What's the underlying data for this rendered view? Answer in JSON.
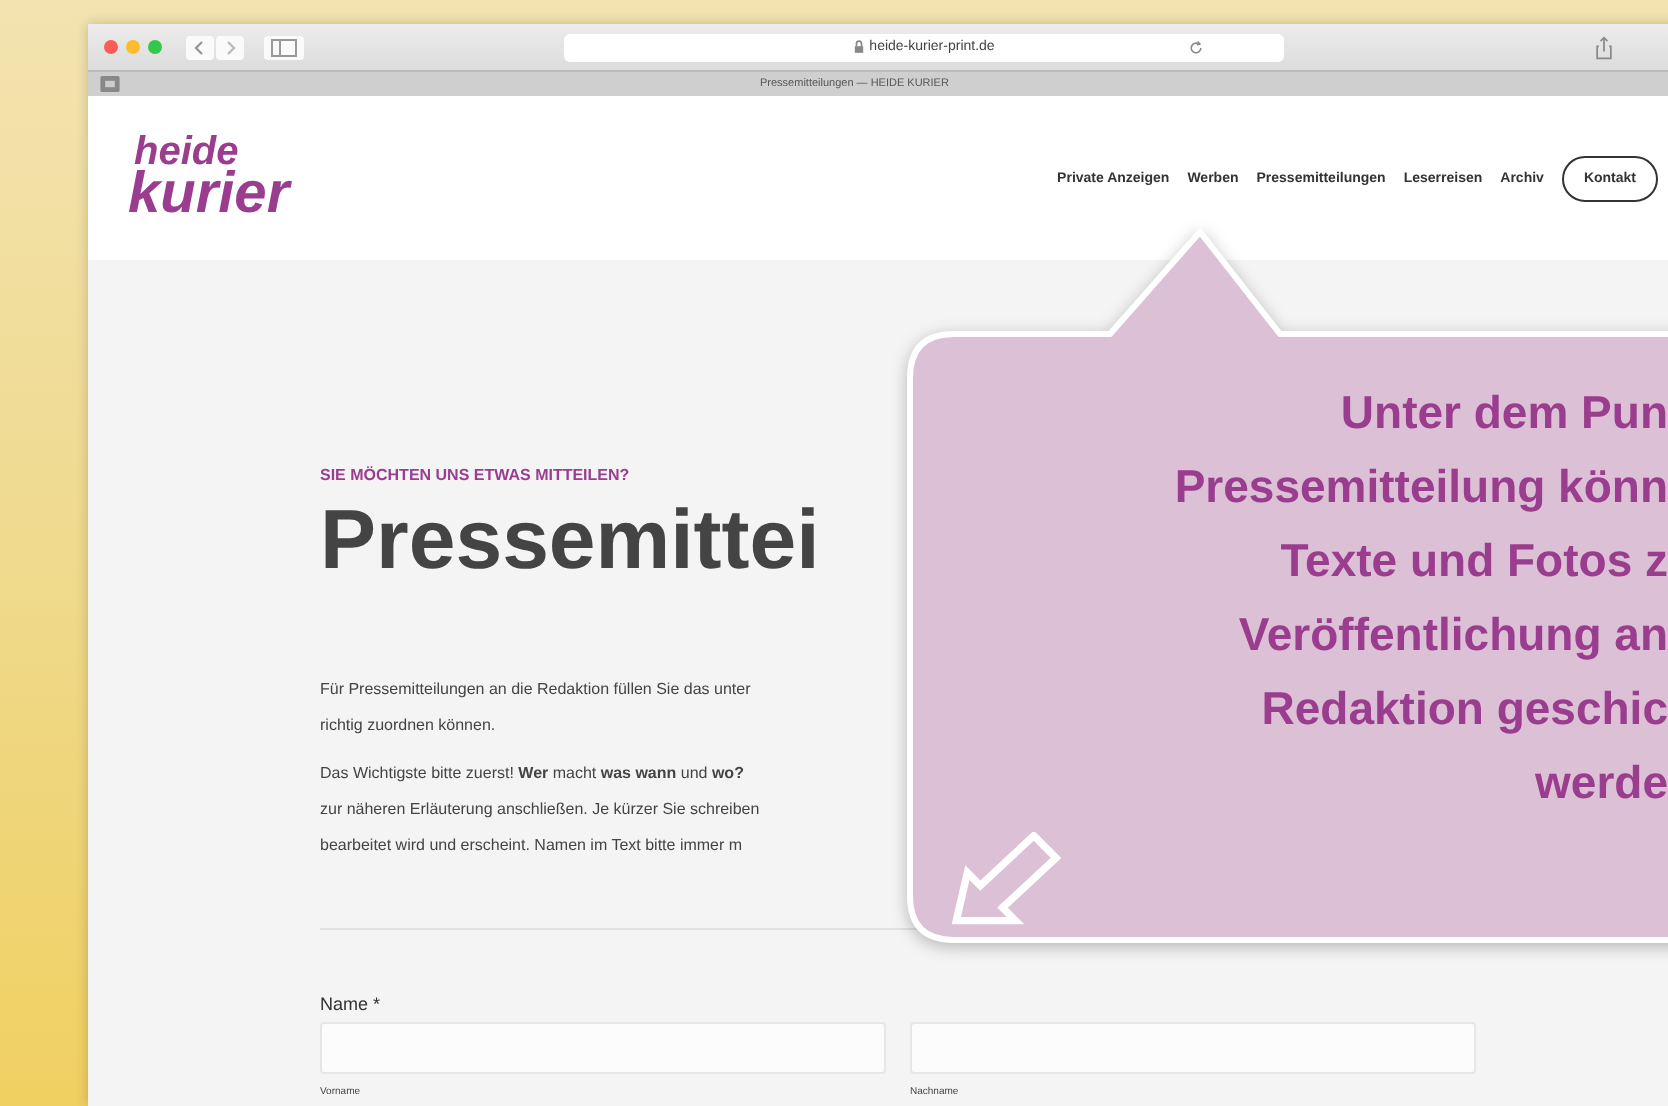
{
  "browser": {
    "url": "heide-kurier-print.de",
    "tab_title": "Pressemitteilungen — HEIDE KURIER"
  },
  "header": {
    "logo_lines": [
      "heide",
      "kurier"
    ],
    "nav": [
      {
        "label": "Private Anzeigen",
        "kind": "link"
      },
      {
        "label": "Werben",
        "kind": "link"
      },
      {
        "label": "Pressemitteilungen",
        "kind": "link"
      },
      {
        "label": "Leserreisen",
        "kind": "link"
      },
      {
        "label": "Archiv",
        "kind": "link"
      },
      {
        "label": "Kontakt",
        "kind": "button"
      }
    ]
  },
  "content": {
    "eyebrow": "SIE MÖCHTEN UNS ETWAS MITTEILEN?",
    "heading": "Pressemittei",
    "paragraphs": [
      [
        "Für Pressemitteilungen an die Redaktion füllen Sie das unter",
        "richtig zuordnen können."
      ],
      [
        "Das Wichtigste bitte zuerst! **Wer** macht **was wann** und **wo?**",
        "zur näheren Erläuterung anschließen. Je kürzer Sie schreiben",
        "bearbeitet wird und erscheint. Namen im Text bitte immer m"
      ]
    ],
    "form": {
      "label": "Name *",
      "fields": [
        {
          "sublabel": "Vorname"
        },
        {
          "sublabel": "Nachname"
        }
      ]
    }
  },
  "callout": {
    "lines": [
      "Unter dem Pun",
      "Pressemitteilung könn",
      "Texte und Fotos z",
      "Veröffentlichung an",
      "Redaktion geschic",
      "werde"
    ]
  }
}
